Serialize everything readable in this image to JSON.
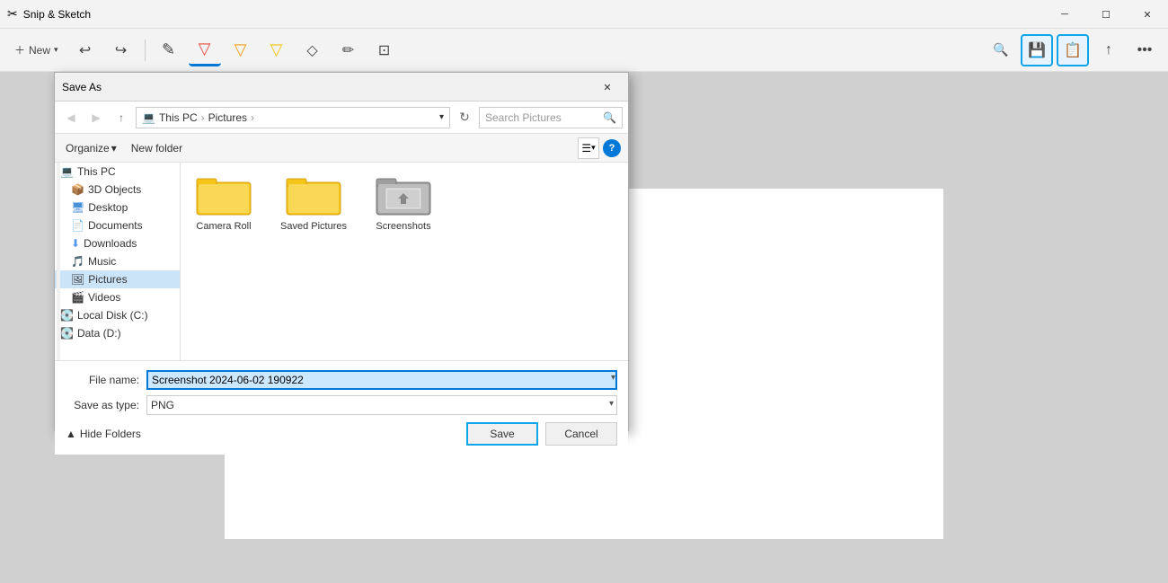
{
  "app": {
    "title": "Snip & Sketch",
    "titlebar_controls": [
      "minimize",
      "maximize",
      "close"
    ]
  },
  "toolbar": {
    "tools": [
      {
        "id": "touch-writing",
        "icon": "✎",
        "label": "Touch writing"
      },
      {
        "id": "ballpoint-pen",
        "icon": "▽",
        "label": "Ballpoint pen",
        "active": true
      },
      {
        "id": "pencil",
        "icon": "▽",
        "label": "Pencil"
      },
      {
        "id": "highlighter",
        "icon": "▽",
        "label": "Highlighter"
      },
      {
        "id": "eraser",
        "icon": "◇",
        "label": "Eraser"
      },
      {
        "id": "pen",
        "icon": "✏",
        "label": "Pen"
      },
      {
        "id": "crop",
        "icon": "⊡",
        "label": "Crop"
      }
    ],
    "right_tools": [
      {
        "id": "zoom-out",
        "icon": "🔍",
        "label": "Zoom out"
      },
      {
        "id": "save",
        "icon": "💾",
        "label": "Save",
        "highlighted": true
      },
      {
        "id": "copy",
        "icon": "📋",
        "label": "Copy",
        "highlighted": true
      },
      {
        "id": "share",
        "icon": "↑",
        "label": "Share"
      },
      {
        "id": "more",
        "icon": "...",
        "label": "More"
      }
    ],
    "new_btn": {
      "label": "New"
    },
    "undo": "↩",
    "redo": "↪"
  },
  "dialog": {
    "title": "Save As",
    "close_label": "✕",
    "address_bar": {
      "back_disabled": true,
      "forward_disabled": true,
      "up_label": "↑",
      "breadcrumb": [
        "This PC",
        "Pictures"
      ],
      "search_placeholder": "Search Pictures"
    },
    "toolbar": {
      "organize_label": "Organize",
      "new_folder_label": "New folder",
      "view_icon": "☰",
      "chevron": "▾",
      "help_label": "?"
    },
    "sidebar": {
      "items": [
        {
          "id": "this-pc",
          "icon": "💻",
          "label": "This PC"
        },
        {
          "id": "3d-objects",
          "icon": "📦",
          "label": "3D Objects"
        },
        {
          "id": "desktop",
          "icon": "🖥",
          "label": "Desktop"
        },
        {
          "id": "documents",
          "icon": "📄",
          "label": "Documents"
        },
        {
          "id": "downloads",
          "icon": "⬇",
          "label": "Downloads"
        },
        {
          "id": "music",
          "icon": "🎵",
          "label": "Music"
        },
        {
          "id": "pictures",
          "icon": "🖼",
          "label": "Pictures",
          "selected": true
        },
        {
          "id": "videos",
          "icon": "🎬",
          "label": "Videos"
        },
        {
          "id": "local-disk",
          "icon": "💽",
          "label": "Local Disk (C:)"
        },
        {
          "id": "data",
          "icon": "💽",
          "label": "Data (D:)"
        }
      ]
    },
    "folders": [
      {
        "id": "camera-roll",
        "name": "Camera Roll",
        "type": "regular"
      },
      {
        "id": "saved-pictures",
        "name": "Saved Pictures",
        "type": "regular"
      },
      {
        "id": "screenshots",
        "name": "Screenshots",
        "type": "special"
      }
    ],
    "form": {
      "filename_label": "File name:",
      "filename_value": "Screenshot 2024-06-02 190922",
      "savetype_label": "Save as type:",
      "savetype_value": "PNG"
    },
    "actions": {
      "hide_folders_label": "Hide Folders",
      "save_label": "Save",
      "cancel_label": "Cancel"
    }
  }
}
